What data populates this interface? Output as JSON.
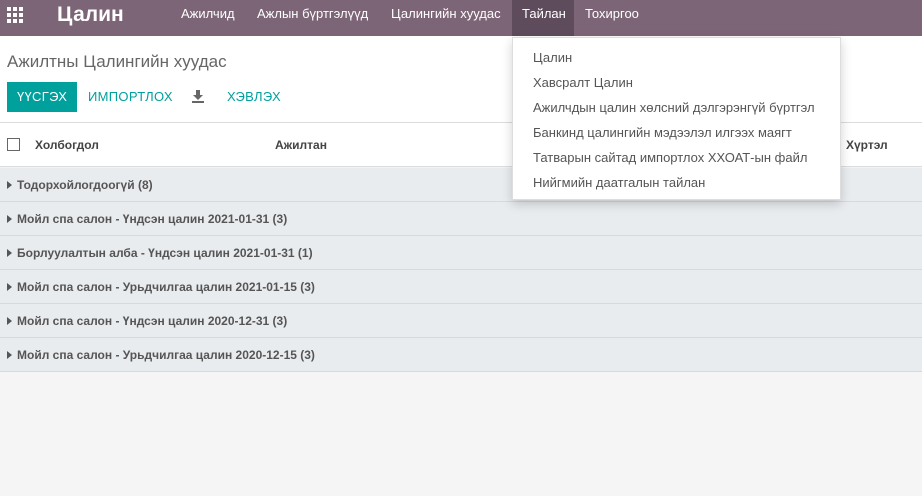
{
  "app": {
    "title": "Цалин"
  },
  "nav": {
    "items": [
      {
        "label": "Ажилчид"
      },
      {
        "label": "Ажлын бүртгэлүүд"
      },
      {
        "label": "Цалингийн хуудас"
      },
      {
        "label": "Тайлан",
        "active": true
      },
      {
        "label": "Тохиргоо"
      }
    ]
  },
  "breadcrumb": "Ажилтны Цалингийн хуудас",
  "toolbar": {
    "create_label": "ҮҮСГЭХ",
    "import_label": "ИМПОРТЛОХ",
    "download_icon": "download-icon",
    "share_label": "ХЭВЛЭХ"
  },
  "columns": {
    "contact": "Холбогдол",
    "employee": "Ажилтан",
    "to": "Хүртэл"
  },
  "groups": [
    {
      "label": "Тодорхойлогдоогүй (8)"
    },
    {
      "label": "Мойл спа салон - Үндсэн цалин 2021-01-31 (3)"
    },
    {
      "label": "Борлуулалтын алба - Үндсэн цалин 2021-01-31 (1)"
    },
    {
      "label": "Мойл спа салон - Урьдчилгаа цалин 2021-01-15 (3)"
    },
    {
      "label": "Мойл спа салон - Үндсэн цалин 2020-12-31 (3)"
    },
    {
      "label": "Мойл спа салон - Урьдчилгаа цалин 2020-12-15 (3)"
    }
  ],
  "report_menu": {
    "items": [
      {
        "label": "Цалин"
      },
      {
        "label": "Хавсралт Цалин"
      },
      {
        "label": "Ажилчдын цалин хөлсний дэлгэрэнгүй бүртгэл"
      },
      {
        "label": "Банкинд цалингийн мэдээлэл илгээх маягт"
      },
      {
        "label": "Татварын сайтад импортлох ХХОАТ-ын файл"
      },
      {
        "label": "Нийгмийн даатгалын тайлан"
      }
    ]
  },
  "colors": {
    "topbar": "#7c6577",
    "accent": "#00a09d",
    "group_bg": "#e9ecef"
  }
}
